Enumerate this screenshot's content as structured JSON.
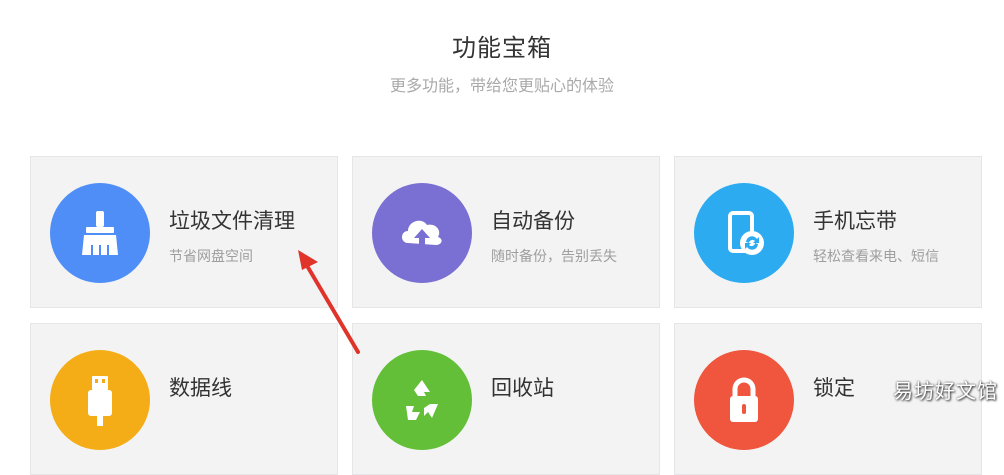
{
  "header": {
    "title": "功能宝箱",
    "subtitle": "更多功能，带给您更贴心的体验"
  },
  "cards": [
    {
      "title": "垃圾文件清理",
      "desc": "节省网盘空间",
      "icon": "broom-icon",
      "color": "#4f8ef7"
    },
    {
      "title": "自动备份",
      "desc": "随时备份，告别丢失",
      "icon": "cloud-upload-icon",
      "color": "#7a6fd2"
    },
    {
      "title": "手机忘带",
      "desc": "轻松查看来电、短信",
      "icon": "phone-sync-icon",
      "color": "#2cabf0"
    },
    {
      "title": "数据线",
      "desc": "",
      "icon": "usb-cable-icon",
      "color": "#f4ad17"
    },
    {
      "title": "回收站",
      "desc": "",
      "icon": "recycle-icon",
      "color": "#62bf37"
    },
    {
      "title": "锁定",
      "desc": "",
      "icon": "lock-icon",
      "color": "#f0563d"
    }
  ],
  "annotation": {
    "arrow_color": "#e0342b"
  },
  "watermark": {
    "text": "易坊好文馆"
  }
}
